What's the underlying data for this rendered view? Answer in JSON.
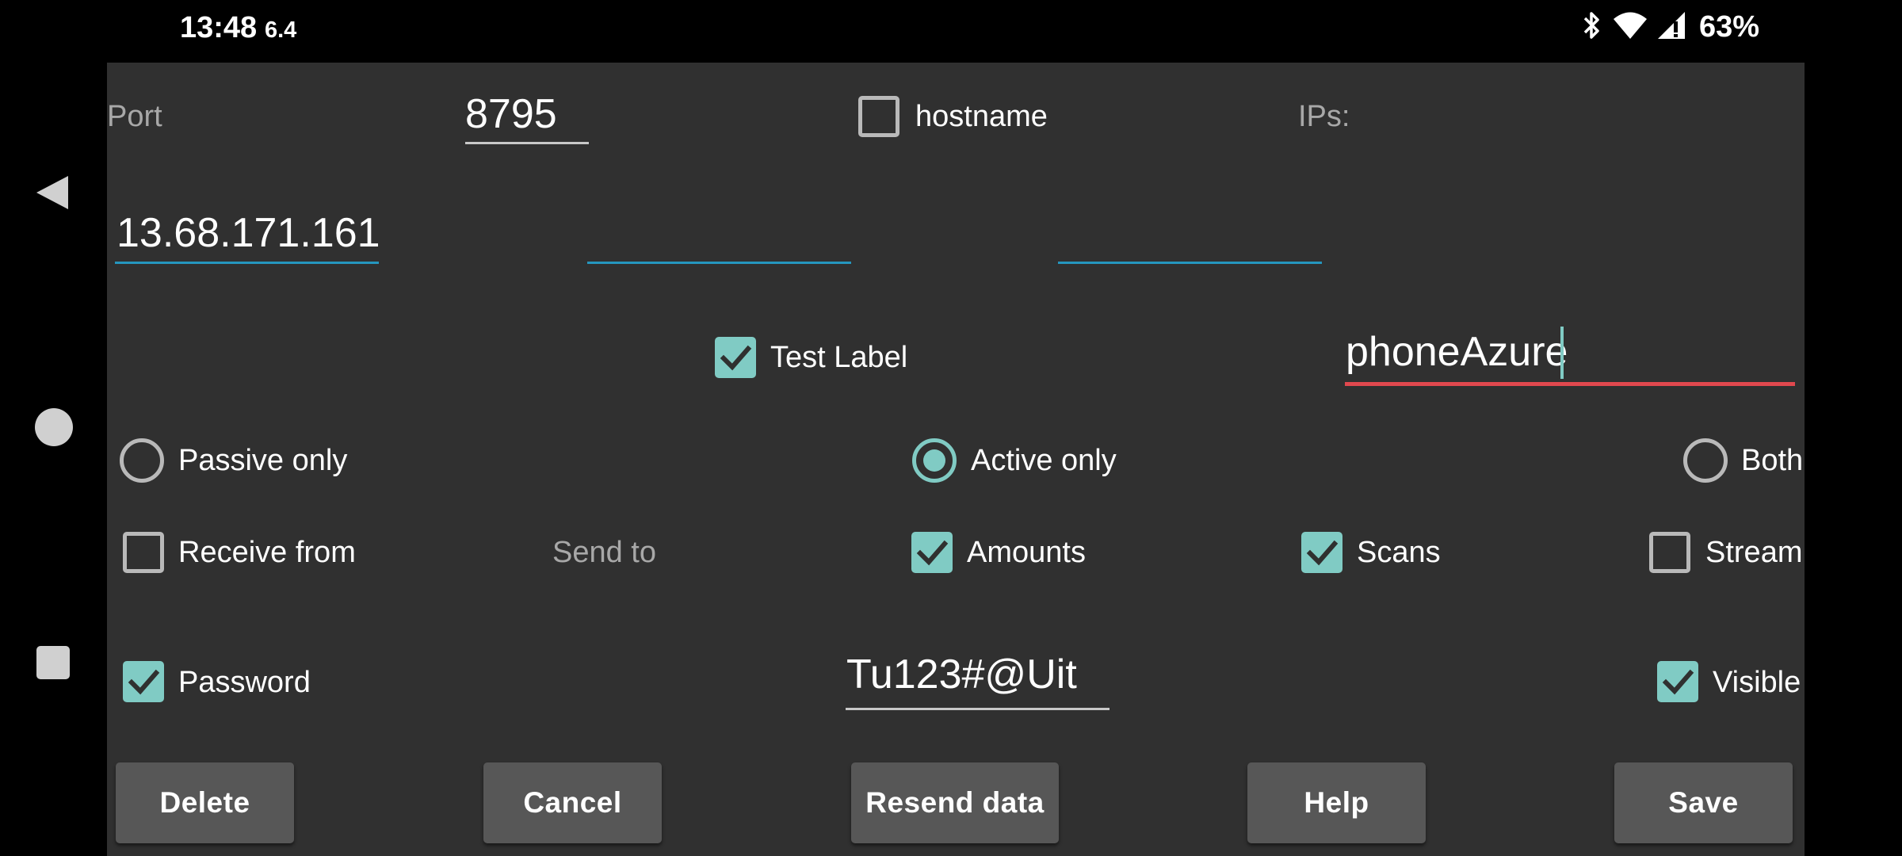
{
  "status_bar": {
    "time": "13:48",
    "sub": "6.4",
    "battery": "63%",
    "icons": [
      "bluetooth-icon",
      "wifi-icon",
      "signal-icon"
    ]
  },
  "nav_bar": {
    "icons": [
      "back-icon",
      "home-icon",
      "recents-icon"
    ]
  },
  "form": {
    "port_label": "Port",
    "port_value": "8795",
    "hostname_label": "hostname",
    "hostname_checked": false,
    "ips_label": "IPs:",
    "ip1_value": "13.68.171.161",
    "ip2_value": "",
    "ip3_value": "",
    "test_label": "Test Label",
    "test_label_checked": true,
    "name_value": "phoneAzure",
    "mode_options": [
      {
        "label": "Passive only",
        "selected": false
      },
      {
        "label": "Active only",
        "selected": true
      },
      {
        "label": "Both",
        "selected": false
      }
    ],
    "receive_from_label": "Receive from",
    "receive_from_checked": false,
    "send_to_label": "Send to",
    "amounts_label": "Amounts",
    "amounts_checked": true,
    "scans_label": "Scans",
    "scans_checked": true,
    "stream_label": "Stream",
    "stream_checked": false,
    "password_label": "Password",
    "password_checked": true,
    "password_value": "Tu123#@Uit",
    "visible_label": "Visible",
    "visible_checked": true
  },
  "buttons": {
    "delete": "Delete",
    "cancel": "Cancel",
    "resend": "Resend data",
    "help": "Help",
    "save": "Save"
  },
  "colors": {
    "accent": "#80cbc4",
    "focus_underline": "#2596be",
    "error_underline": "#e0484e",
    "panel_background": "#303030",
    "button_background": "#575757"
  }
}
